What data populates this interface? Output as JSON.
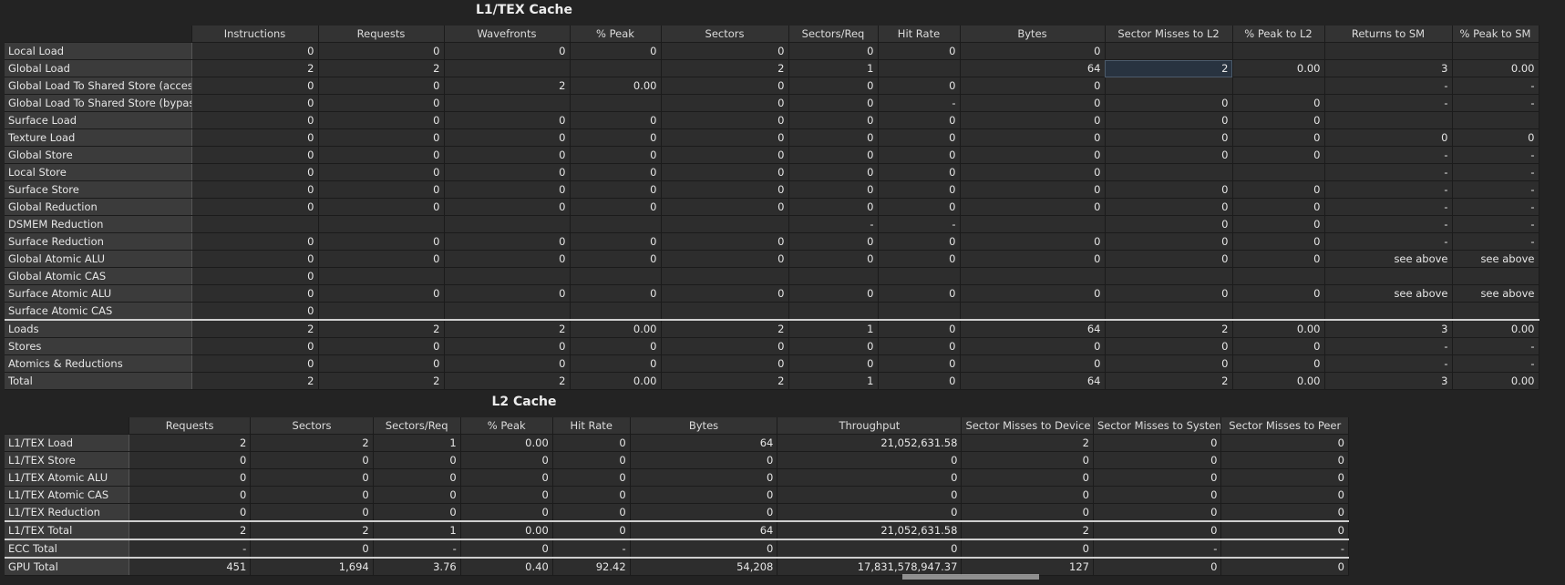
{
  "l1": {
    "title": "L1/TEX Cache",
    "columns": [
      "Instructions",
      "Requests",
      "Wavefronts",
      "% Peak",
      "Sectors",
      "Sectors/Req",
      "Hit Rate",
      "Bytes",
      "Sector Misses to L2",
      "% Peak to L2",
      "Returns to SM",
      "% Peak to SM"
    ],
    "rows": [
      {
        "label": "Local Load",
        "cells": [
          "0",
          "0",
          "0",
          "0",
          "0",
          "0",
          "0",
          "0",
          "",
          "",
          "",
          ""
        ]
      },
      {
        "label": "Global Load",
        "cells": [
          "2",
          "2",
          "",
          "",
          "2",
          "1",
          "",
          "64",
          "2",
          "0.00",
          "3",
          "0.00"
        ]
      },
      {
        "label": "Global Load To Shared Store (access)",
        "cells": [
          "0",
          "0",
          "2",
          "0.00",
          "0",
          "0",
          "0",
          "0",
          "",
          "",
          "-",
          "-"
        ]
      },
      {
        "label": "Global Load To Shared Store (bypass)",
        "cells": [
          "0",
          "0",
          "",
          "",
          "0",
          "0",
          "-",
          "0",
          "0",
          "0",
          "-",
          "-"
        ]
      },
      {
        "label": "Surface Load",
        "cells": [
          "0",
          "0",
          "0",
          "0",
          "0",
          "0",
          "0",
          "0",
          "0",
          "0",
          "",
          ""
        ]
      },
      {
        "label": "Texture Load",
        "cells": [
          "0",
          "0",
          "0",
          "0",
          "0",
          "0",
          "0",
          "0",
          "0",
          "0",
          "0",
          "0"
        ]
      },
      {
        "label": "Global Store",
        "cells": [
          "0",
          "0",
          "0",
          "0",
          "0",
          "0",
          "0",
          "0",
          "0",
          "0",
          "-",
          "-"
        ]
      },
      {
        "label": "Local Store",
        "cells": [
          "0",
          "0",
          "0",
          "0",
          "0",
          "0",
          "0",
          "0",
          "",
          "",
          "-",
          "-"
        ]
      },
      {
        "label": "Surface Store",
        "cells": [
          "0",
          "0",
          "0",
          "0",
          "0",
          "0",
          "0",
          "0",
          "0",
          "0",
          "-",
          "-"
        ]
      },
      {
        "label": "Global Reduction",
        "cells": [
          "0",
          "0",
          "0",
          "0",
          "0",
          "0",
          "0",
          "0",
          "0",
          "0",
          "-",
          "-"
        ]
      },
      {
        "label": "DSMEM Reduction",
        "cells": [
          "",
          "",
          "",
          "",
          "",
          "-",
          "-",
          "",
          "0",
          "0",
          "-",
          "-"
        ]
      },
      {
        "label": "Surface Reduction",
        "cells": [
          "0",
          "0",
          "0",
          "0",
          "0",
          "0",
          "0",
          "0",
          "0",
          "0",
          "-",
          "-"
        ]
      },
      {
        "label": "Global Atomic ALU",
        "cells": [
          "0",
          "0",
          "0",
          "0",
          "0",
          "0",
          "0",
          "0",
          "0",
          "0",
          "see above",
          "see above"
        ]
      },
      {
        "label": "Global Atomic CAS",
        "cells": [
          "0",
          "",
          "",
          "",
          "",
          "",
          "",
          "",
          "",
          "",
          "",
          ""
        ]
      },
      {
        "label": "Surface Atomic ALU",
        "cells": [
          "0",
          "0",
          "0",
          "0",
          "0",
          "0",
          "0",
          "0",
          "0",
          "0",
          "see above",
          "see above"
        ]
      },
      {
        "label": "Surface Atomic CAS",
        "cells": [
          "0",
          "",
          "",
          "",
          "",
          "",
          "",
          "",
          "",
          "",
          "",
          ""
        ]
      },
      {
        "label": "Loads",
        "cells": [
          "2",
          "2",
          "2",
          "0.00",
          "2",
          "1",
          "0",
          "64",
          "2",
          "0.00",
          "3",
          "0.00"
        ]
      },
      {
        "label": "Stores",
        "cells": [
          "0",
          "0",
          "0",
          "0",
          "0",
          "0",
          "0",
          "0",
          "0",
          "0",
          "-",
          "-"
        ]
      },
      {
        "label": "Atomics & Reductions",
        "cells": [
          "0",
          "0",
          "0",
          "0",
          "0",
          "0",
          "0",
          "0",
          "0",
          "0",
          "-",
          "-"
        ]
      },
      {
        "label": "Total",
        "cells": [
          "2",
          "2",
          "2",
          "0.00",
          "2",
          "1",
          "0",
          "64",
          "2",
          "0.00",
          "3",
          "0.00"
        ]
      }
    ]
  },
  "l2": {
    "title": "L2 Cache",
    "columns": [
      "Requests",
      "Sectors",
      "Sectors/Req",
      "% Peak",
      "Hit Rate",
      "Bytes",
      "Throughput",
      "Sector Misses to Device",
      "Sector Misses to System",
      "Sector Misses to Peer"
    ],
    "rows": [
      {
        "label": "L1/TEX Load",
        "cells": [
          "2",
          "2",
          "1",
          "0.00",
          "0",
          "64",
          "21,052,631.58",
          "2",
          "0",
          "0"
        ]
      },
      {
        "label": "L1/TEX Store",
        "cells": [
          "0",
          "0",
          "0",
          "0",
          "0",
          "0",
          "0",
          "0",
          "0",
          "0"
        ]
      },
      {
        "label": "L1/TEX Atomic ALU",
        "cells": [
          "0",
          "0",
          "0",
          "0",
          "0",
          "0",
          "0",
          "0",
          "0",
          "0"
        ]
      },
      {
        "label": "L1/TEX Atomic CAS",
        "cells": [
          "0",
          "0",
          "0",
          "0",
          "0",
          "0",
          "0",
          "0",
          "0",
          "0"
        ]
      },
      {
        "label": "L1/TEX Reduction",
        "cells": [
          "0",
          "0",
          "0",
          "0",
          "0",
          "0",
          "0",
          "0",
          "0",
          "0"
        ]
      },
      {
        "label": "L1/TEX Total",
        "cells": [
          "2",
          "2",
          "1",
          "0.00",
          "0",
          "64",
          "21,052,631.58",
          "2",
          "0",
          "0"
        ]
      },
      {
        "label": "ECC Total",
        "cells": [
          "-",
          "0",
          "-",
          "0",
          "-",
          "0",
          "0",
          "0",
          "-",
          "-"
        ]
      },
      {
        "label": "GPU Total",
        "cells": [
          "451",
          "1,694",
          "3.76",
          "0.40",
          "92.42",
          "54,208",
          "17,831,578,947.37",
          "127",
          "0",
          "0"
        ]
      }
    ]
  }
}
